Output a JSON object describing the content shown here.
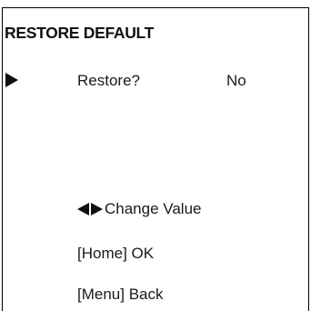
{
  "menu": {
    "title": "RESTORE DEFAULT",
    "cursor_icon": "play-triangle-icon",
    "row": {
      "label": "Restore?",
      "value": "No"
    }
  },
  "hints": {
    "change_value_icons": [
      "left-arrow-icon",
      "right-arrow-icon"
    ],
    "change_value": "Change Value",
    "home": "[Home] OK",
    "menu": "[Menu] Back"
  }
}
